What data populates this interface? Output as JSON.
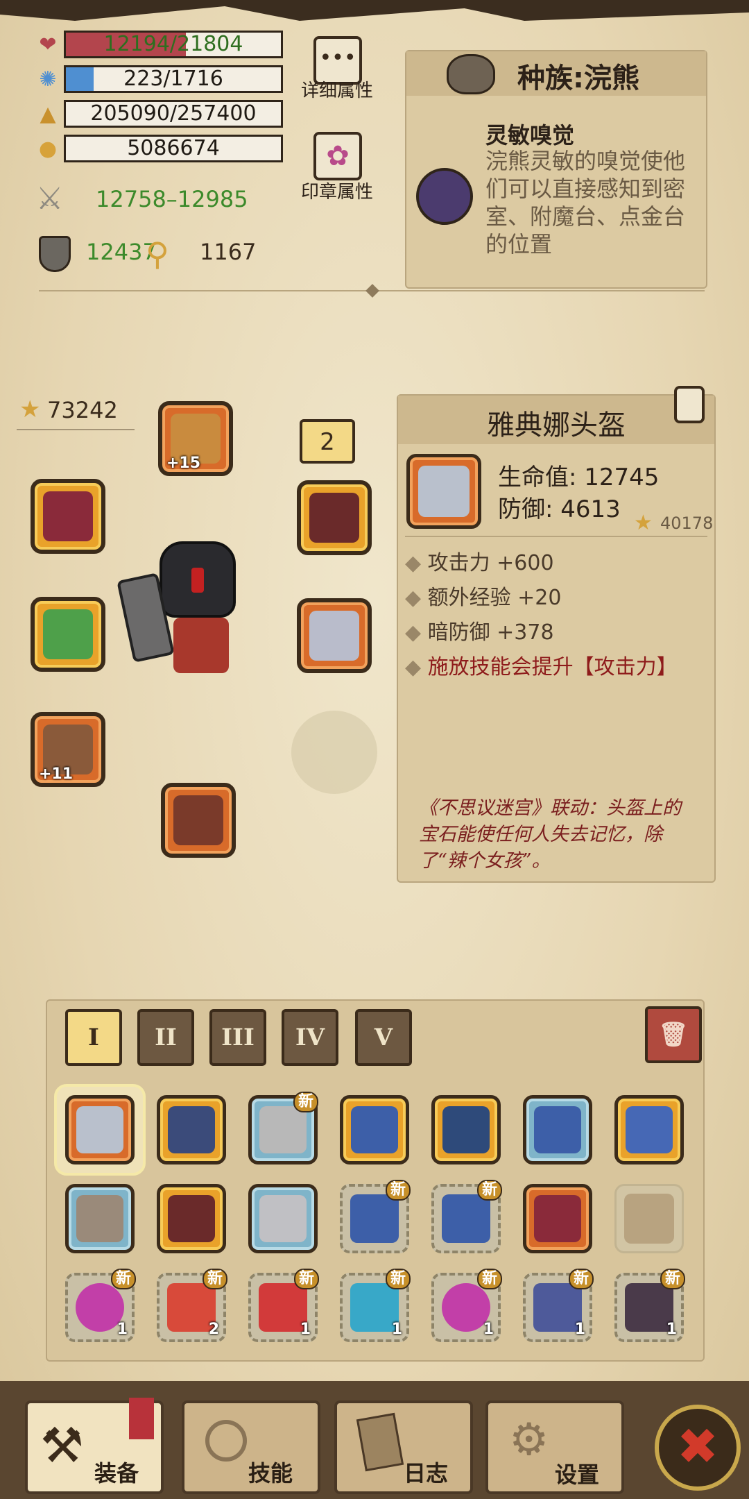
{
  "stats": {
    "hp": "12194/21804",
    "hp_ratio": 0.559,
    "mp": "223/1716",
    "mp_ratio": 0.13,
    "exp": "205090/257400",
    "gold": "5086674",
    "attack": "12758–12985",
    "defense": "12437",
    "luck": "1167"
  },
  "buttons": {
    "detail_attr": "详细属性",
    "seal_attr": "印章属性"
  },
  "race": {
    "title": "种族:浣熊",
    "skill_name": "灵敏嗅觉",
    "skill_desc": "浣熊灵敏的嗅觉使他们可以直接感知到密室、附魔台、点金台的位置"
  },
  "character": {
    "power": "73242",
    "slot_count": "2",
    "helmet_plus": "+15",
    "ring_plus": "+11"
  },
  "item_detail": {
    "name": "雅典娜头盔",
    "hp": "生命值: 12745",
    "defense": "防御: 4613",
    "power": "40178",
    "bonuses": [
      "攻击力 +600",
      "额外经验 +20",
      "暗防御 +378"
    ],
    "special": "施放技能会提升【攻击力】",
    "lore": "《不思议迷宫》联动：头盔上的宝石能使任何人失去记忆，除了“辣个女孩”。"
  },
  "tabs": [
    "I",
    "II",
    "III",
    "IV",
    "V"
  ],
  "inventory": {
    "new_label": "新",
    "counts": [
      "1",
      "2",
      "1",
      "1",
      "1",
      "1",
      "1"
    ]
  },
  "nav": {
    "equip": "装备",
    "skills": "技能",
    "log": "日志",
    "settings": "设置"
  },
  "colors": {
    "hp": "#b3454d",
    "mp": "#4f8fd1",
    "green": "#3c8a2b",
    "red_text": "#8e1b1b"
  }
}
